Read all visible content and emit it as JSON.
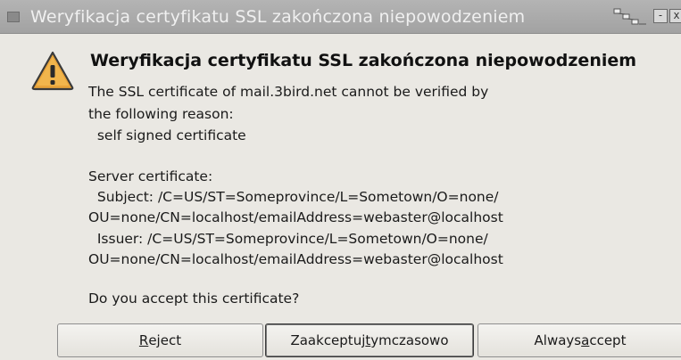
{
  "window": {
    "title": "Weryfikacja certyfikatu SSL zakończona niepowodzeniem"
  },
  "dialog": {
    "icon": "warning-icon",
    "heading": "Weryfikacja certyfikatu SSL zakończona niepowodzeniem",
    "lines": [
      "The SSL certificate of mail.3bird.net cannot be verified by",
      "the following reason:",
      "  self signed certificate",
      "Server certificate:",
      "  Subject: /C=US/ST=Someprovince/L=Sometown/O=none/",
      "OU=none/CN=localhost/emailAddress=webaster@localhost",
      "  Issuer: /C=US/ST=Someprovince/L=Sometown/O=none/",
      "OU=none/CN=localhost/emailAddress=webaster@localhost",
      "Do you accept this certificate?"
    ]
  },
  "buttons": {
    "reject": {
      "before": "",
      "mnemonic": "R",
      "after": "eject"
    },
    "accept_temp": {
      "before": "Zaakceptuj ",
      "mnemonic": "t",
      "after": "ymczasowo"
    },
    "always": {
      "before": "Always ",
      "mnemonic": "a",
      "after": "ccept"
    }
  }
}
